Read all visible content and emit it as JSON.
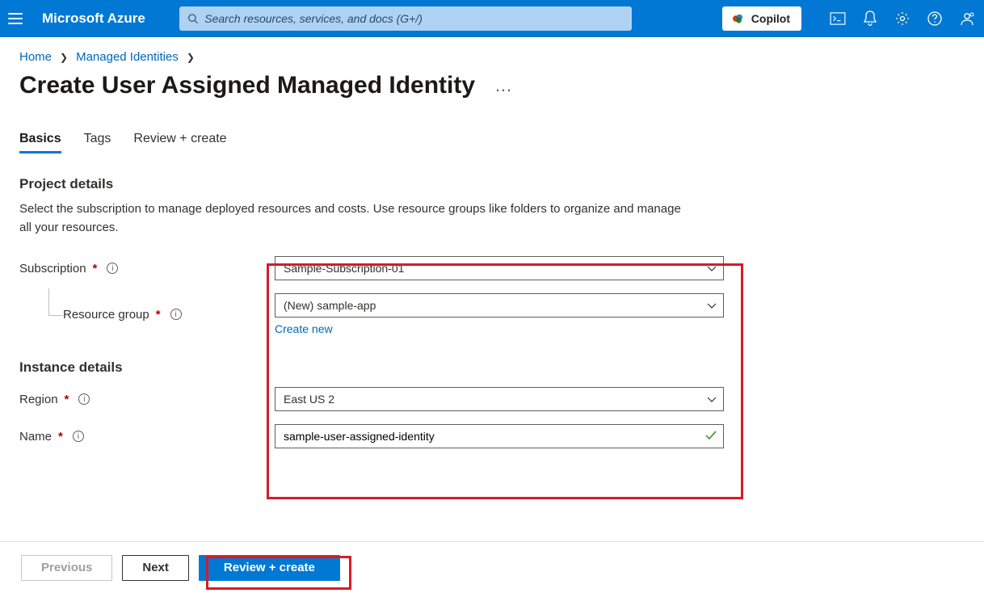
{
  "header": {
    "brand": "Microsoft Azure",
    "search_placeholder": "Search resources, services, and docs (G+/)",
    "copilot_label": "Copilot"
  },
  "breadcrumb": {
    "items": [
      "Home",
      "Managed Identities"
    ]
  },
  "page_title": "Create User Assigned Managed Identity",
  "tabs": [
    "Basics",
    "Tags",
    "Review + create"
  ],
  "active_tab": "Basics",
  "sections": {
    "project": {
      "title": "Project details",
      "description": "Select the subscription to manage deployed resources and costs. Use resource groups like folders to organize and manage all your resources."
    },
    "instance": {
      "title": "Instance details"
    }
  },
  "form": {
    "subscription": {
      "label": "Subscription",
      "value": "Sample-Subscription-01"
    },
    "resource_group": {
      "label": "Resource group",
      "value": "(New) sample-app",
      "create_new": "Create new"
    },
    "region": {
      "label": "Region",
      "value": "East US 2"
    },
    "name": {
      "label": "Name",
      "value": "sample-user-assigned-identity"
    }
  },
  "footer": {
    "previous": "Previous",
    "next": "Next",
    "review": "Review + create"
  }
}
